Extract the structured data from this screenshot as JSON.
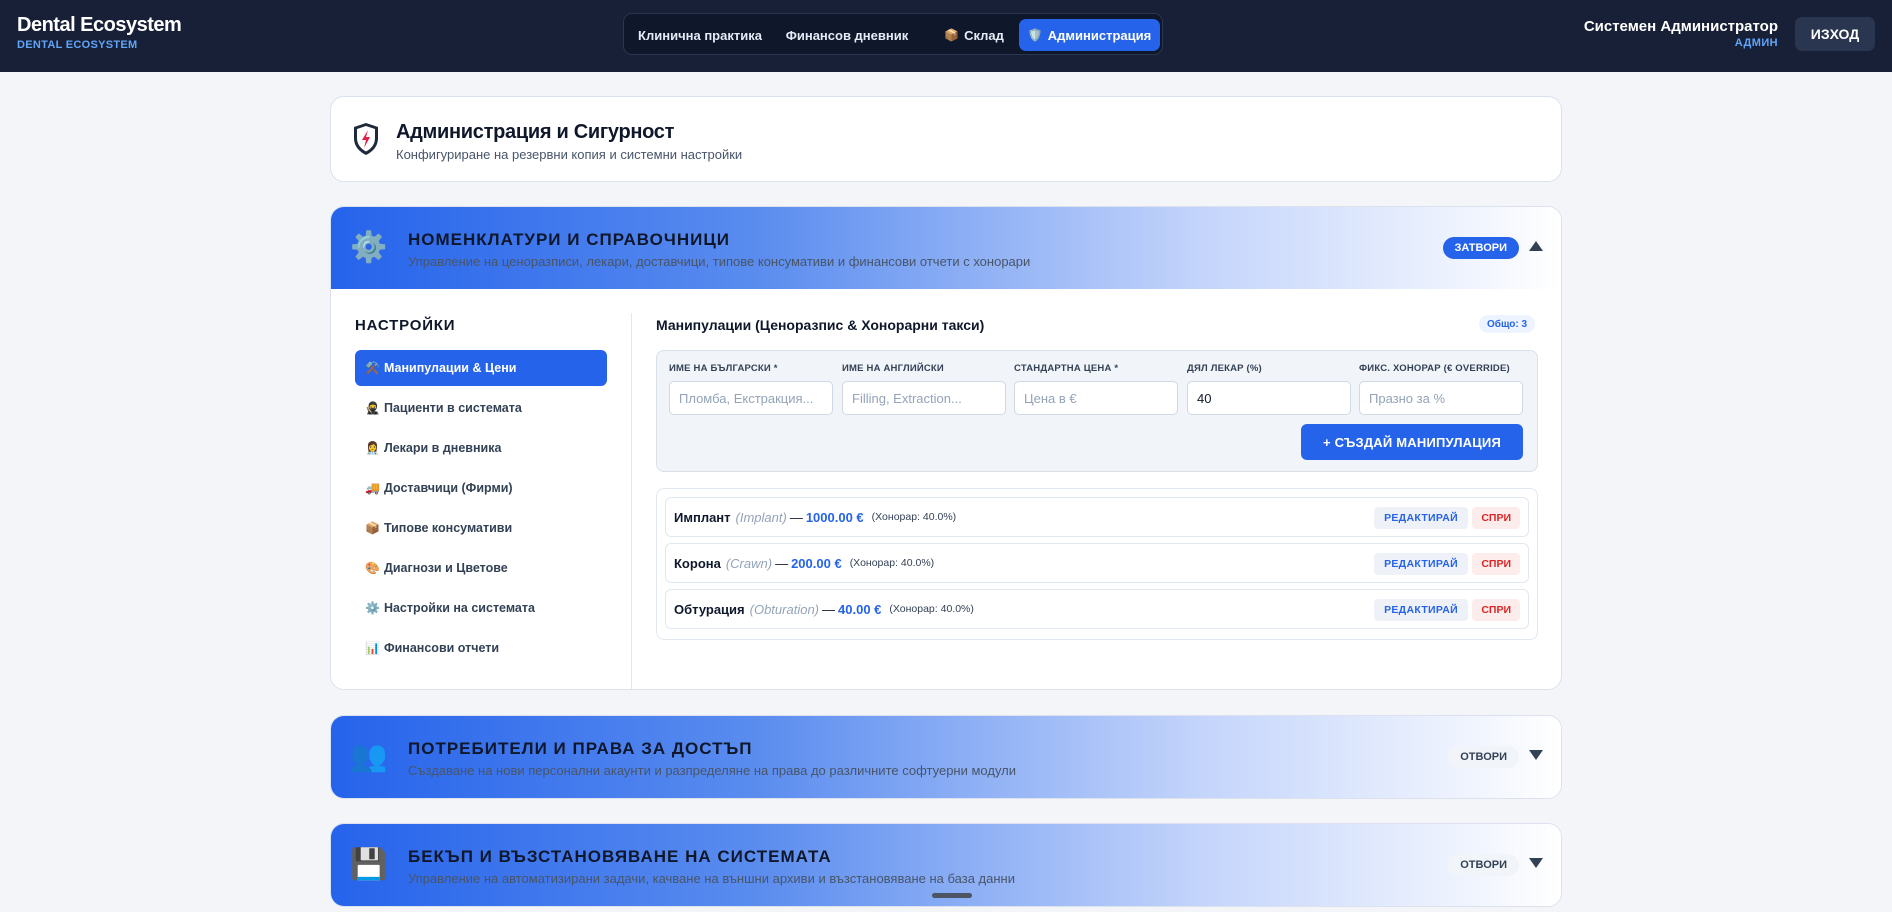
{
  "brand": {
    "title": "Dental Ecosystem",
    "subtitle": "DENTAL ECOSYSTEM"
  },
  "nav": {
    "tabs": [
      {
        "label": "Клинична практика",
        "icon": ""
      },
      {
        "label": "Финансов дневник",
        "icon": ""
      },
      {
        "label": "Склад",
        "icon": "📦"
      },
      {
        "label": "Администрация",
        "icon": "🛡️"
      }
    ]
  },
  "user": {
    "name": "Системен Администратор",
    "role": "АДМИН",
    "logout": "ИЗХОД"
  },
  "page": {
    "title": "Администрация и Сигурност",
    "subtitle": "Конфигуриране на резервни копия и системни настройки",
    "icon": "shield-icon"
  },
  "sections": {
    "nomenclature": {
      "title": "НОМЕНКЛАТУРИ И СПРАВОЧНИЦИ",
      "subtitle": "Управление на ценоразписи, лекари, доставчици, типове консумативи и финансови отчети с хонорари",
      "toggle": "ЗАТВОРИ",
      "icon": "⚙️"
    },
    "users": {
      "title": "ПОТРЕБИТЕЛИ И ПРАВА ЗА ДОСТЪП",
      "subtitle": "Създаване на нови персонални акаунти и разпределяне на права до различните софтуерни модули",
      "toggle": "ОТВОРИ",
      "icon": "👥"
    },
    "backup": {
      "title": "БЕКЪП И ВЪЗСТАНОВЯВАНЕ НА СИСТЕМАТА",
      "subtitle": "Управление на автоматизирани задачи, качване на външни архиви и възстановяване на база данни",
      "toggle": "ОТВОРИ",
      "icon": "💾"
    }
  },
  "sidebar": {
    "title": "НАСТРОЙКИ",
    "items": [
      {
        "icon": "⚒️",
        "label": "Манипулации & Цени"
      },
      {
        "icon": "🥷",
        "label": "Пациенти в системата"
      },
      {
        "icon": "👩‍⚕️",
        "label": "Лекари в дневника"
      },
      {
        "icon": "🚚",
        "label": "Доставчици (Фирми)"
      },
      {
        "icon": "📦",
        "label": "Типове консумативи"
      },
      {
        "icon": "🎨",
        "label": "Диагнози и Цветове"
      },
      {
        "icon": "⚙️",
        "label": "Настройки на системата"
      },
      {
        "icon": "📊",
        "label": "Финансови отчети"
      }
    ]
  },
  "content": {
    "title": "Манипулации (Ценоразпис & Хонорарни такси)",
    "count_label": "Общо: 3",
    "form": {
      "fields": [
        {
          "label": "ИМЕ НА БЪЛГАРСКИ *",
          "placeholder": "Пломба, Екстракция...",
          "value": ""
        },
        {
          "label": "ИМЕ НА АНГЛИЙСКИ",
          "placeholder": "Filling, Extraction...",
          "value": ""
        },
        {
          "label": "СТАНДАРТНА ЦЕНА *",
          "placeholder": "Цена в €",
          "value": ""
        },
        {
          "label": "ДЯЛ ЛЕКАР (%)",
          "placeholder": "",
          "value": "40"
        },
        {
          "label": "ФИКС. ХОНОРАР (€ OVERRIDE)",
          "placeholder": "Празно за %",
          "value": ""
        }
      ],
      "create_label": "+ СЪЗДАЙ МАНИПУЛАЦИЯ"
    },
    "rows": [
      {
        "name": "Имплант",
        "en": "(Implant)",
        "price": "1000.00 €",
        "fee": "(Хонорар: 40.0%)"
      },
      {
        "name": "Корона",
        "en": "(Crawn)",
        "price": "200.00 €",
        "fee": "(Хонорар: 40.0%)"
      },
      {
        "name": "Обтурация",
        "en": "(Obturation)",
        "price": "40.00 €",
        "fee": "(Хонорар: 40.0%)"
      }
    ],
    "edit_label": "РЕДАКТИРАЙ",
    "stop_label": "СПРИ",
    "dash": "—"
  },
  "colors": {
    "accent": "#2563eb",
    "topbar": "#172036",
    "danger": "#dc2626"
  }
}
